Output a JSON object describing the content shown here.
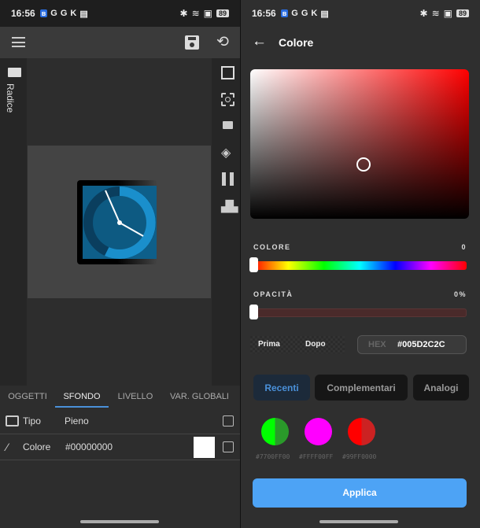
{
  "status": {
    "time": "16:56",
    "battery": "89",
    "icons": [
      "G",
      "G",
      "K"
    ]
  },
  "left": {
    "sidebar_label": "Radice",
    "tabs": [
      {
        "label": "OGGETTI"
      },
      {
        "label": "SFONDO",
        "active": true
      },
      {
        "label": "LIVELLO"
      },
      {
        "label": "VAR. GLOBALI"
      }
    ],
    "rows": [
      {
        "label": "Tipo",
        "value": "Pieno"
      },
      {
        "label": "Colore",
        "value": "#00000000"
      }
    ]
  },
  "right": {
    "title": "Colore",
    "hue_label": "COLORE",
    "hue_value": "0",
    "opacity_label": "OPACITÀ",
    "opacity_value": "0%",
    "before_label": "Prima",
    "after_label": "Dopo",
    "hex_label": "HEX",
    "hex_value": "#005D2C2C",
    "pills": [
      {
        "label": "Recenti",
        "active": true
      },
      {
        "label": "Complementari"
      },
      {
        "label": "Analogi"
      }
    ],
    "swatches": [
      {
        "hex": "#7700FF00",
        "color": "#00ff00"
      },
      {
        "hex": "#FFFF00FF",
        "color": "#ff00ff"
      },
      {
        "hex": "#99FF0000",
        "color": "#ff0000"
      }
    ],
    "apply_label": "Applica",
    "accent": "#4da3f5"
  }
}
